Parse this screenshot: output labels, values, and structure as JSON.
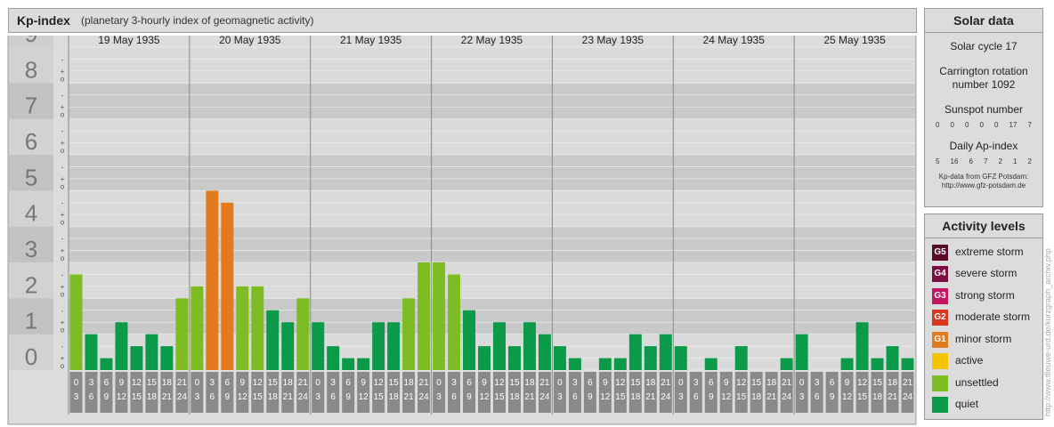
{
  "header": {
    "title": "Kp-index",
    "subtitle": "(planetary 3-hourly index of geomagnetic activity)"
  },
  "chart_data": {
    "type": "bar",
    "title": "Kp-index",
    "subtitle": "(planetary 3-hourly index of geomagnetic activity)",
    "ylim": [
      0,
      9
    ],
    "y_ticks": [
      "0",
      "1",
      "2",
      "3",
      "4",
      "5",
      "6",
      "7",
      "8",
      "9"
    ],
    "minor_tick_labels": [
      "-",
      "o",
      "+"
    ],
    "days": [
      "19 May 1935",
      "20 May 1935",
      "21 May 1935",
      "22 May 1935",
      "23 May 1935",
      "24 May 1935",
      "25 May 1935"
    ],
    "interval_starts": [
      "0",
      "3",
      "6",
      "9",
      "12",
      "15",
      "18",
      "21"
    ],
    "interval_ends": [
      "3",
      "6",
      "9",
      "12",
      "15",
      "18",
      "21",
      "24"
    ],
    "series": [
      {
        "values": [
          2.667,
          1.0,
          0.333,
          1.333,
          0.667,
          1.0,
          0.667,
          2.0,
          2.333,
          5.0,
          4.667,
          2.333,
          2.333,
          1.667,
          1.333,
          2.0,
          1.333,
          0.667,
          0.333,
          0.333,
          1.333,
          1.333,
          2.0,
          3.0,
          3.0,
          2.667,
          1.667,
          0.667,
          1.333,
          0.667,
          1.333,
          1.0,
          0.667,
          0.333,
          0.0,
          0.333,
          0.333,
          1.0,
          0.667,
          1.0,
          0.667,
          0.0,
          0.333,
          0.0,
          0.667,
          0.0,
          0.0,
          0.333,
          1.0,
          0.0,
          0.0,
          0.333,
          1.333,
          0.333,
          0.667,
          0.333
        ]
      }
    ],
    "colors": {
      "quiet": "#0a9a4a",
      "unsettled": "#7dbd23",
      "minor": "#e27b1e"
    },
    "grid": true
  },
  "solar": {
    "heading": "Solar data",
    "cycle": "Solar cycle 17",
    "carrington_1": "Carrington rotation",
    "carrington_2": "number 1092",
    "sunspot_heading": "Sunspot number",
    "sunspots": [
      "0",
      "0",
      "0",
      "0",
      "0",
      "17",
      "7"
    ],
    "ap_heading": "Daily Ap-index",
    "ap": [
      "5",
      "16",
      "6",
      "7",
      "2",
      "1",
      "2"
    ],
    "source_1": "Kp-data from GFZ Potsdam:",
    "source_2": "http://www.gfz-potsdam.de"
  },
  "activity": {
    "heading": "Activity levels",
    "levels": [
      {
        "badge": "G5",
        "name": "extreme storm",
        "color": "#5a0a2a"
      },
      {
        "badge": "G4",
        "name": "severe storm",
        "color": "#7a0e3e"
      },
      {
        "badge": "G3",
        "name": "strong storm",
        "color": "#c2165e"
      },
      {
        "badge": "G2",
        "name": "moderate storm",
        "color": "#d9361e"
      },
      {
        "badge": "G1",
        "name": "minor storm",
        "color": "#e27b1e"
      },
      {
        "badge": "",
        "name": "active",
        "color": "#f5c400"
      },
      {
        "badge": "",
        "name": "unsettled",
        "color": "#7dbd23"
      },
      {
        "badge": "",
        "name": "quiet",
        "color": "#0a9a4a"
      }
    ]
  },
  "watermark": "http://www.tlieuwe-urd.de/kurzgraph_archiv.php"
}
